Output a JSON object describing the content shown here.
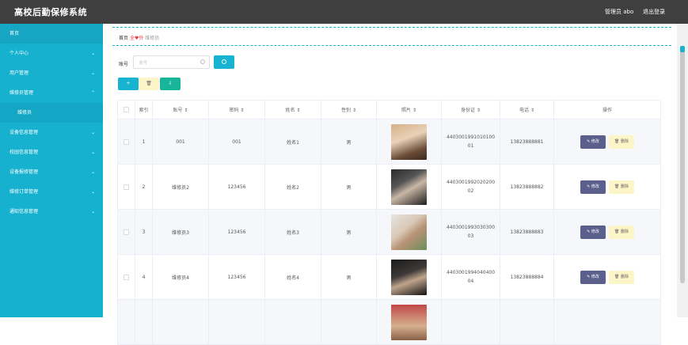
{
  "app": {
    "title": "高校后勤保修系统",
    "user_label": "管理员 abo",
    "logout_label": "退出登录"
  },
  "sidebar": {
    "items": [
      {
        "label": "首页",
        "chevron": ""
      },
      {
        "label": "个人中心",
        "chevron": "⌄"
      },
      {
        "label": "用户管理",
        "chevron": "⌄"
      },
      {
        "label": "维修员管理",
        "chevron": "⌃"
      },
      {
        "label": "维修员",
        "chevron": ""
      },
      {
        "label": "设备信息管理",
        "chevron": "⌄"
      },
      {
        "label": "校园信息管理",
        "chevron": "⌄"
      },
      {
        "label": "设备报修管理",
        "chevron": "⌄"
      },
      {
        "label": "维修订单管理",
        "chevron": "⌄"
      },
      {
        "label": "通知信息管理",
        "chevron": "⌄"
      }
    ]
  },
  "breadcrumb": {
    "home": "首页",
    "heart": "♥",
    "middle_left": "全",
    "middle_right": "外",
    "current": "维修员"
  },
  "search": {
    "label": "账号",
    "placeholder": "账号"
  },
  "actions": {
    "add": "+",
    "delete": "🗑",
    "export": "⇩"
  },
  "table": {
    "headers": [
      "",
      "索引",
      "账号 ⇕",
      "密码 ⇕",
      "姓名 ⇕",
      "性别 ⇕",
      "照片 ⇕",
      "身份证 ⇕",
      "电话 ⇕",
      "操作"
    ],
    "rows": [
      {
        "index": "1",
        "account": "001",
        "password": "001",
        "name": "姓名1",
        "gender": "男",
        "id_card": "4403001991010100\n01",
        "phone": "13823888881"
      },
      {
        "index": "2",
        "account": "维修员2",
        "password": "123456",
        "name": "姓名2",
        "gender": "男",
        "id_card": "4403001992020200\n02",
        "phone": "13823888882"
      },
      {
        "index": "3",
        "account": "维修员3",
        "password": "123456",
        "name": "姓名3",
        "gender": "男",
        "id_card": "4403001993030300\n03",
        "phone": "13823888883"
      },
      {
        "index": "4",
        "account": "维修员4",
        "password": "123456",
        "name": "姓名4",
        "gender": "男",
        "id_card": "4403001994040400\n04",
        "phone": "13823888884"
      }
    ],
    "edit_label": "✎ 修改",
    "delete_label": "🗑 删除"
  },
  "colors": {
    "sidebar": "#15b1cf",
    "topbar": "#3f3f3f",
    "accent": "#17b3d0",
    "edit": "#5a5f8c",
    "delete": "#fcf5c8"
  }
}
